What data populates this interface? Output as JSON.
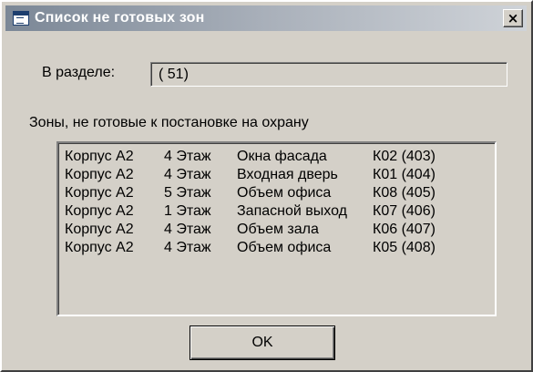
{
  "window": {
    "title": "Список не готовых зон",
    "close_label": "×"
  },
  "section": {
    "label": "В разделе:",
    "value": "( 51)"
  },
  "zones": {
    "heading": "Зоны, не готовые к постановке на охрану",
    "rows": [
      {
        "building": "Корпус А2",
        "floor": "4 Этаж",
        "zone": "Окна фасада",
        "code": "К02 (403)"
      },
      {
        "building": "Корпус А2",
        "floor": "4 Этаж",
        "zone": "Входная дверь",
        "code": "К01 (404)"
      },
      {
        "building": "Корпус А2",
        "floor": "5 Этаж",
        "zone": "Объем офиса",
        "code": "К08 (405)"
      },
      {
        "building": "Корпус А2",
        "floor": "1 Этаж",
        "zone": "Запасной выход",
        "code": "К07 (406)"
      },
      {
        "building": "Корпус А2",
        "floor": "4 Этаж",
        "zone": "Объем зала",
        "code": "К06 (407)"
      },
      {
        "building": "Корпус А2",
        "floor": "4 Этаж",
        "zone": "Объем офиса",
        "code": "К05 (408)"
      }
    ]
  },
  "buttons": {
    "ok_label": "OK"
  }
}
